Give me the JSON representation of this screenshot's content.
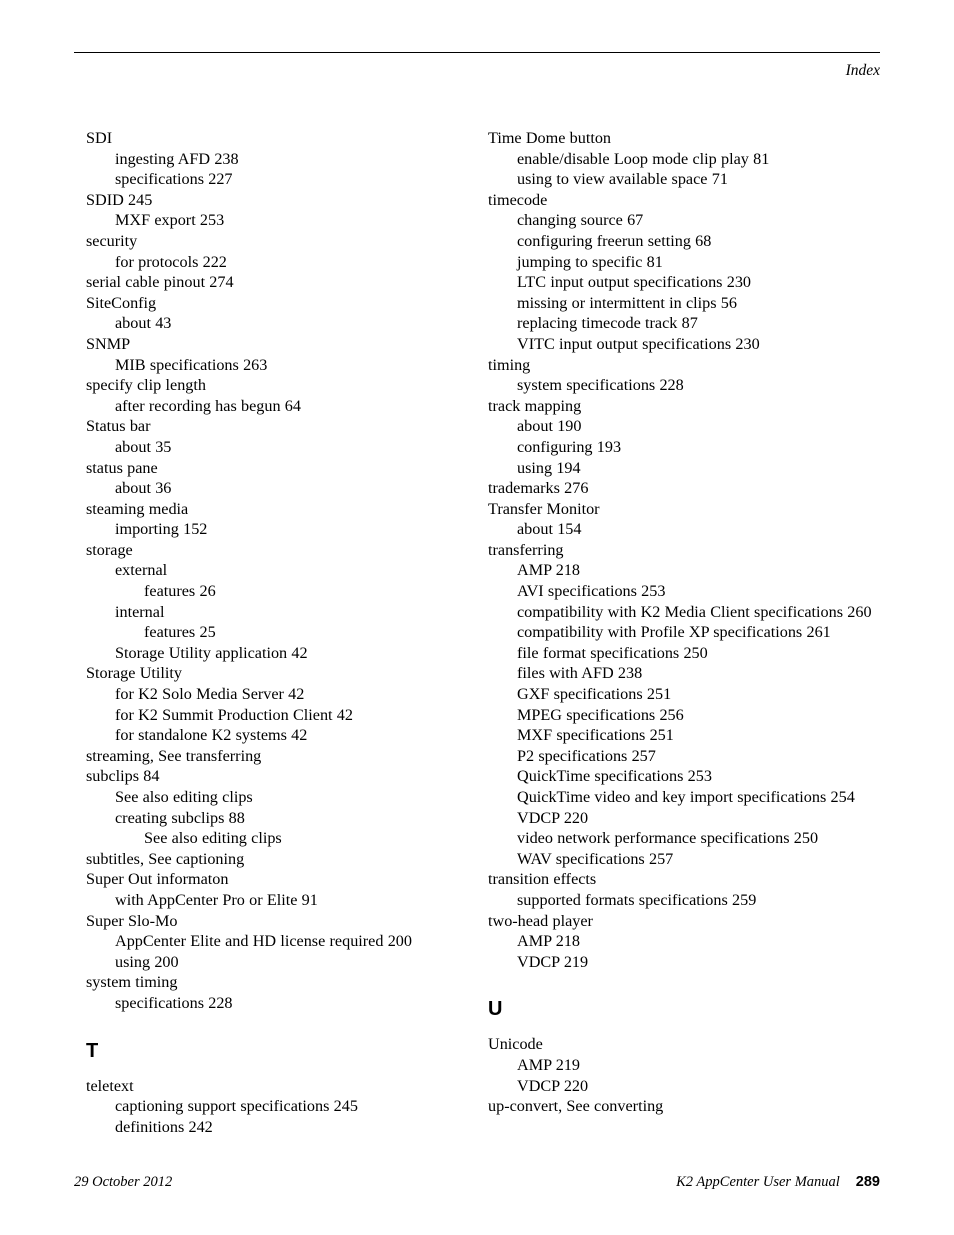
{
  "header": {
    "title": "Index"
  },
  "footer": {
    "date": "29 October 2012",
    "manual_title": "K2 AppCenter User Manual",
    "page_number": "289"
  },
  "columns": {
    "left": [
      {
        "type": "entry",
        "level": 0,
        "text": "SDI"
      },
      {
        "type": "entry",
        "level": 1,
        "text": "ingesting AFD 238"
      },
      {
        "type": "entry",
        "level": 1,
        "text": "specifications 227"
      },
      {
        "type": "entry",
        "level": 0,
        "text": "SDID 245"
      },
      {
        "type": "entry",
        "level": 1,
        "text": "MXF export 253"
      },
      {
        "type": "entry",
        "level": 0,
        "text": "security"
      },
      {
        "type": "entry",
        "level": 1,
        "text": "for protocols 222"
      },
      {
        "type": "entry",
        "level": 0,
        "text": "serial cable pinout 274"
      },
      {
        "type": "entry",
        "level": 0,
        "text": "SiteConfig"
      },
      {
        "type": "entry",
        "level": 1,
        "text": "about 43"
      },
      {
        "type": "entry",
        "level": 0,
        "text": "SNMP"
      },
      {
        "type": "entry",
        "level": 1,
        "text": "MIB specifications 263"
      },
      {
        "type": "entry",
        "level": 0,
        "text": "specify clip length"
      },
      {
        "type": "entry",
        "level": 1,
        "text": "after recording has begun 64"
      },
      {
        "type": "entry",
        "level": 0,
        "text": "Status bar"
      },
      {
        "type": "entry",
        "level": 1,
        "text": "about 35"
      },
      {
        "type": "entry",
        "level": 0,
        "text": "status pane"
      },
      {
        "type": "entry",
        "level": 1,
        "text": "about 36"
      },
      {
        "type": "entry",
        "level": 0,
        "text": "steaming media"
      },
      {
        "type": "entry",
        "level": 1,
        "text": "importing 152"
      },
      {
        "type": "entry",
        "level": 0,
        "text": "storage"
      },
      {
        "type": "entry",
        "level": 1,
        "text": "external"
      },
      {
        "type": "entry",
        "level": 2,
        "text": "features 26"
      },
      {
        "type": "entry",
        "level": 1,
        "text": "internal"
      },
      {
        "type": "entry",
        "level": 2,
        "text": "features 25"
      },
      {
        "type": "entry",
        "level": 1,
        "text": "Storage Utility application 42"
      },
      {
        "type": "entry",
        "level": 0,
        "text": "Storage Utility"
      },
      {
        "type": "entry",
        "level": 1,
        "text": "for K2 Solo Media Server 42"
      },
      {
        "type": "entry",
        "level": 1,
        "text": "for K2 Summit Production Client 42"
      },
      {
        "type": "entry",
        "level": 1,
        "text": "for standalone K2 systems 42"
      },
      {
        "type": "entry",
        "level": 0,
        "text": "streaming, See transferring"
      },
      {
        "type": "entry",
        "level": 0,
        "text": "subclips 84"
      },
      {
        "type": "entry",
        "level": 1,
        "text": "See also editing clips"
      },
      {
        "type": "entry",
        "level": 1,
        "text": "creating subclips 88"
      },
      {
        "type": "entry",
        "level": 2,
        "text": "See also editing clips"
      },
      {
        "type": "entry",
        "level": 0,
        "text": "subtitles, See captioning"
      },
      {
        "type": "entry",
        "level": 0,
        "text": "Super Out informaton"
      },
      {
        "type": "entry",
        "level": 1,
        "text": "with AppCenter Pro or Elite 91"
      },
      {
        "type": "entry",
        "level": 0,
        "text": "Super Slo-Mo"
      },
      {
        "type": "entry",
        "level": 1,
        "text": "AppCenter Elite and HD license required 200"
      },
      {
        "type": "entry",
        "level": 1,
        "text": "using 200"
      },
      {
        "type": "entry",
        "level": 0,
        "text": "system timing"
      },
      {
        "type": "entry",
        "level": 1,
        "text": "specifications 228"
      },
      {
        "type": "heading",
        "text": "T"
      },
      {
        "type": "entry",
        "level": 0,
        "text": "teletext"
      },
      {
        "type": "entry",
        "level": 1,
        "text": "captioning support specifications 245"
      },
      {
        "type": "entry",
        "level": 1,
        "text": "definitions 242"
      }
    ],
    "right": [
      {
        "type": "entry",
        "level": 0,
        "text": "Time Dome button"
      },
      {
        "type": "entry",
        "level": 1,
        "text": "enable/disable Loop mode clip play 81"
      },
      {
        "type": "entry",
        "level": 1,
        "text": "using to view available space 71"
      },
      {
        "type": "entry",
        "level": 0,
        "text": "timecode"
      },
      {
        "type": "entry",
        "level": 1,
        "text": "changing source 67"
      },
      {
        "type": "entry",
        "level": 1,
        "text": "configuring freerun setting 68"
      },
      {
        "type": "entry",
        "level": 1,
        "text": "jumping to specific 81"
      },
      {
        "type": "entry",
        "level": 1,
        "text": "LTC input output specifications 230"
      },
      {
        "type": "entry",
        "level": 1,
        "text": "missing or intermittent in clips 56"
      },
      {
        "type": "entry",
        "level": 1,
        "text": "replacing timecode track 87"
      },
      {
        "type": "entry",
        "level": 1,
        "text": "VITC input output specifications 230"
      },
      {
        "type": "entry",
        "level": 0,
        "text": "timing"
      },
      {
        "type": "entry",
        "level": 1,
        "text": "system specifications 228"
      },
      {
        "type": "entry",
        "level": 0,
        "text": "track mapping"
      },
      {
        "type": "entry",
        "level": 1,
        "text": "about 190"
      },
      {
        "type": "entry",
        "level": 1,
        "text": "configuring 193"
      },
      {
        "type": "entry",
        "level": 1,
        "text": "using 194"
      },
      {
        "type": "entry",
        "level": 0,
        "text": "trademarks 276"
      },
      {
        "type": "entry",
        "level": 0,
        "text": "Transfer Monitor"
      },
      {
        "type": "entry",
        "level": 1,
        "text": "about 154"
      },
      {
        "type": "entry",
        "level": 0,
        "text": "transferring"
      },
      {
        "type": "entry",
        "level": 1,
        "text": "AMP 218"
      },
      {
        "type": "entry",
        "level": 1,
        "text": "AVI specifications 253"
      },
      {
        "type": "entry",
        "level": 1,
        "text": "compatibility with K2 Media Client specifications 260"
      },
      {
        "type": "entry",
        "level": 1,
        "text": "compatibility with Profile XP specifications 261"
      },
      {
        "type": "entry",
        "level": 1,
        "text": "file format specifications 250"
      },
      {
        "type": "entry",
        "level": 1,
        "text": "files with AFD 238"
      },
      {
        "type": "entry",
        "level": 1,
        "text": "GXF specifications 251"
      },
      {
        "type": "entry",
        "level": 1,
        "text": "MPEG specifications 256"
      },
      {
        "type": "entry",
        "level": 1,
        "text": "MXF specifications 251"
      },
      {
        "type": "entry",
        "level": 1,
        "text": "P2 specifications 257"
      },
      {
        "type": "entry",
        "level": 1,
        "text": "QuickTime specifications 253"
      },
      {
        "type": "entry",
        "level": 1,
        "text": "QuickTime video and key import specifications 254"
      },
      {
        "type": "entry",
        "level": 1,
        "text": "VDCP 220"
      },
      {
        "type": "entry",
        "level": 1,
        "text": "video network performance specifications 250"
      },
      {
        "type": "entry",
        "level": 1,
        "text": "WAV specifications 257"
      },
      {
        "type": "entry",
        "level": 0,
        "text": "transition effects"
      },
      {
        "type": "entry",
        "level": 1,
        "text": "supported formats specifications 259"
      },
      {
        "type": "entry",
        "level": 0,
        "text": "two-head player"
      },
      {
        "type": "entry",
        "level": 1,
        "text": "AMP 218"
      },
      {
        "type": "entry",
        "level": 1,
        "text": "VDCP 219"
      },
      {
        "type": "heading",
        "text": "U"
      },
      {
        "type": "entry",
        "level": 0,
        "text": "Unicode"
      },
      {
        "type": "entry",
        "level": 1,
        "text": "AMP 219"
      },
      {
        "type": "entry",
        "level": 1,
        "text": "VDCP 220"
      },
      {
        "type": "entry",
        "level": 0,
        "text": "up-convert, See converting"
      }
    ]
  }
}
